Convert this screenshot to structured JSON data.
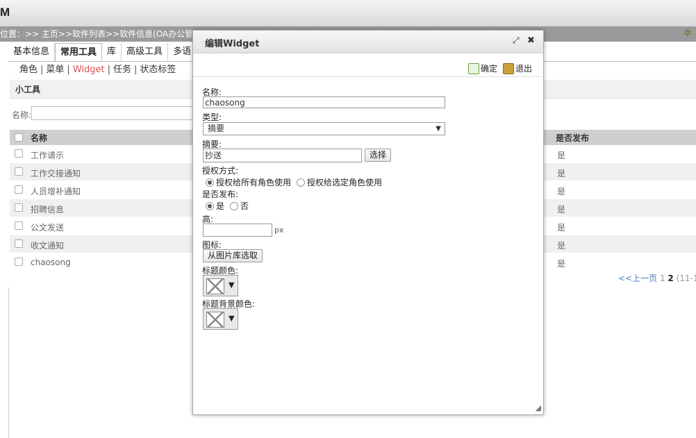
{
  "app": {
    "title": "M"
  },
  "breadcrumb": {
    "text": "位置：>> 主页>>软件列表>>软件信息(OA办公管理系"
  },
  "tabs": [
    {
      "label": "基本信息"
    },
    {
      "label": "常用工具"
    },
    {
      "label": "库"
    },
    {
      "label": "高级工具"
    },
    {
      "label": "多语"
    }
  ],
  "subnav": [
    {
      "label": "角色"
    },
    {
      "label": "菜单"
    },
    {
      "label": "Widget"
    },
    {
      "label": "任务"
    },
    {
      "label": "状态标签"
    }
  ],
  "section": {
    "title": "小工具"
  },
  "search": {
    "label": "名称:",
    "value": ""
  },
  "grid": {
    "headers": {
      "name": "名称",
      "published": "是否发布"
    },
    "rows": [
      {
        "name": "工作请示",
        "published": "是"
      },
      {
        "name": "工作交接通知",
        "published": "是"
      },
      {
        "name": "人员增补通知",
        "published": "是"
      },
      {
        "name": "招聘信息",
        "published": "是"
      },
      {
        "name": "公文发送",
        "published": "是"
      },
      {
        "name": "收文通知",
        "published": "是"
      },
      {
        "name": "chaosong",
        "published": "是"
      }
    ]
  },
  "pager": {
    "prev": "<<上一页",
    "page1": "1",
    "page2": "2",
    "range": "(11-1"
  },
  "dialog": {
    "title": "编辑Widget",
    "restore_icon": "⤢",
    "close_icon": "✖",
    "confirm_label": "确定",
    "exit_label": "退出",
    "fields": {
      "name_label": "名称:",
      "name_value": "chaosong",
      "type_label": "类型:",
      "type_value": "摘要",
      "summary_label": "摘要:",
      "summary_value": "抄送",
      "select_button": "选择",
      "auth_label": "授权方式:",
      "auth_all": "授权给所有角色使用",
      "auth_selected": "授权给选定角色使用",
      "publish_label": "是否发布:",
      "publish_yes": "是",
      "publish_no": "否",
      "height_label": "高:",
      "height_value": "",
      "height_unit": "px",
      "icon_label": "图标:",
      "icon_button": "从图片库选取",
      "title_color_label": "标题颜色:",
      "title_bg_color_label": "标题背景颜色:"
    }
  }
}
